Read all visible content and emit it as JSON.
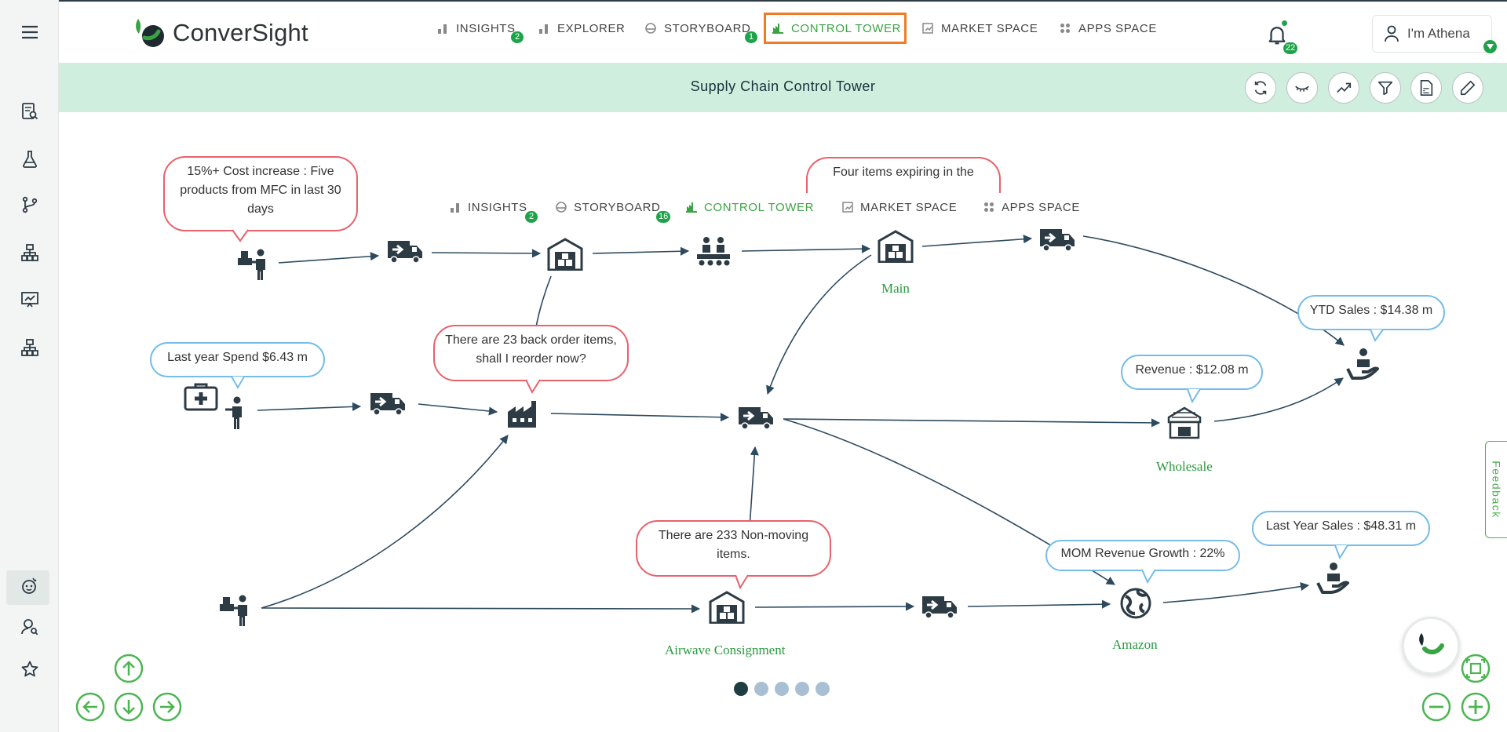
{
  "app": {
    "logo_text": "ConverSight",
    "brand_color": "#3aa343"
  },
  "nav": {
    "insights": "INSIGHTS",
    "insights_badge": "2",
    "explorer": "EXPLORER",
    "storyboard": "STORYBOARD",
    "storyboard_badge": "1",
    "control_tower": "CONTROL TOWER",
    "market_space": "MARKET SPACE",
    "apps_space": "APPS SPACE"
  },
  "notifications": {
    "count": "22"
  },
  "profile": {
    "label": "I'm Athena"
  },
  "band": {
    "title": "Supply Chain Control Tower"
  },
  "toolbar": [
    "refresh-icon",
    "eye-closed-icon",
    "trend-icon",
    "filter-icon",
    "pdf-icon",
    "pencil-icon"
  ],
  "subnav": {
    "insights": "INSIGHTS",
    "insights_badge": "2",
    "storyboard": "STORYBOARD",
    "storyboard_badge": "16",
    "control_tower": "CONTROL TOWER",
    "market_space": "MARKET SPACE",
    "apps_space": "APPS SPACE"
  },
  "callouts": {
    "cost_increase": "15%+ Cost increase : Five products from MFC in last 30 days",
    "expiring": "Four items expiring in the",
    "last_year_spend": "Last year Spend $6.43 m",
    "back_order": "There are 23 back order items, shall I reorder now?",
    "ytd_sales": "YTD Sales : $14.38 m",
    "revenue": "Revenue : $12.08 m",
    "non_moving": "There are 233 Non-moving items.",
    "mom_growth": "MOM Revenue Growth : 22%",
    "last_year_sales": "Last Year Sales : $48.31 m"
  },
  "node_labels": {
    "main": "Main",
    "wholesale": "Wholesale",
    "airwave": "Airwave Consignment",
    "amazon": "Amazon"
  },
  "pager": {
    "count": 5,
    "active": 1
  },
  "feedback": "Feedback"
}
